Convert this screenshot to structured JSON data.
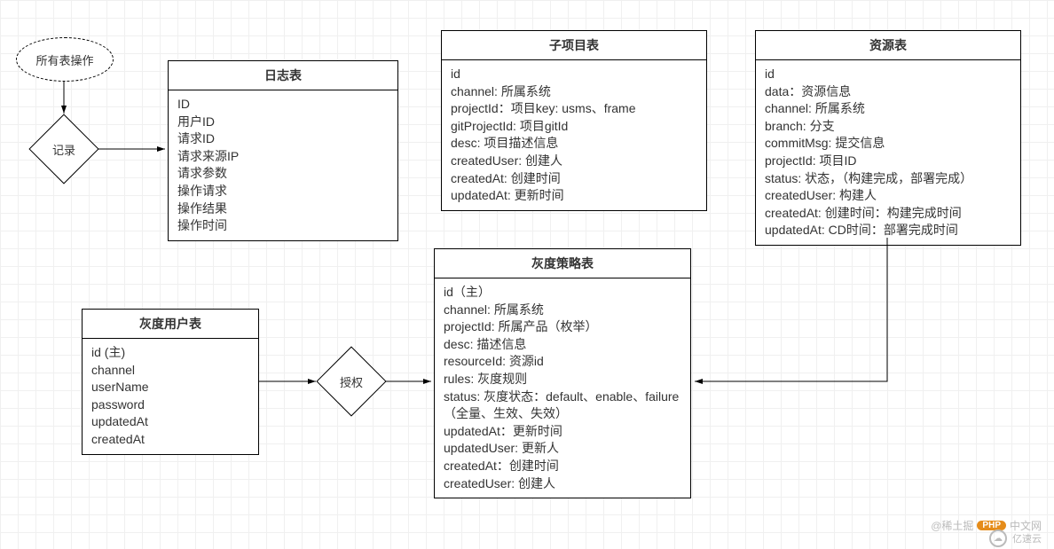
{
  "ellipse": {
    "label": "所有表操作"
  },
  "diamonds": {
    "record": "记录",
    "auth": "授权"
  },
  "tables": {
    "log": {
      "title": "日志表",
      "fields": [
        "ID",
        "用户ID",
        "请求ID",
        "请求来源IP",
        "请求参数",
        "操作请求",
        "操作结果",
        "操作时间"
      ]
    },
    "subproject": {
      "title": "子项目表",
      "fields": [
        "id",
        "channel: 所属系统",
        "projectId：项目key: usms、frame",
        "gitProjectId: 项目gitId",
        "desc: 项目描述信息",
        "createdUser: 创建人",
        "createdAt: 创建时间",
        "updatedAt: 更新时间"
      ]
    },
    "resource": {
      "title": "资源表",
      "fields": [
        "id",
        "data：资源信息",
        "channel: 所属系统",
        "branch: 分支",
        "commitMsg: 提交信息",
        "projectId: 项目ID",
        "status: 状态，（构建完成，部署完成）",
        "createdUser: 构建人",
        "createdAt: 创建时间：构建完成时间",
        "updatedAt: CD时间：部署完成时间"
      ]
    },
    "grayuser": {
      "title": "灰度用户表",
      "fields": [
        "id (主)",
        "channel",
        "userName",
        "password",
        "updatedAt",
        "createdAt"
      ]
    },
    "graypolicy": {
      "title": "灰度策略表",
      "fields": [
        "id（主）",
        "channel: 所属系统",
        "projectId: 所属产品（枚举）",
        "desc: 描述信息",
        "resourceId: 资源id",
        "rules: 灰度规则",
        "status: 灰度状态：default、enable、failure（全量、生效、失效）",
        "updatedAt：更新时间",
        "updatedUser: 更新人",
        "createdAt：创建时间",
        "createdUser: 创建人"
      ]
    }
  },
  "watermark": {
    "line1_prefix": "@稀土掘",
    "pill": "PHP",
    "line1_suffix": "中文网",
    "line2": "亿速云"
  }
}
